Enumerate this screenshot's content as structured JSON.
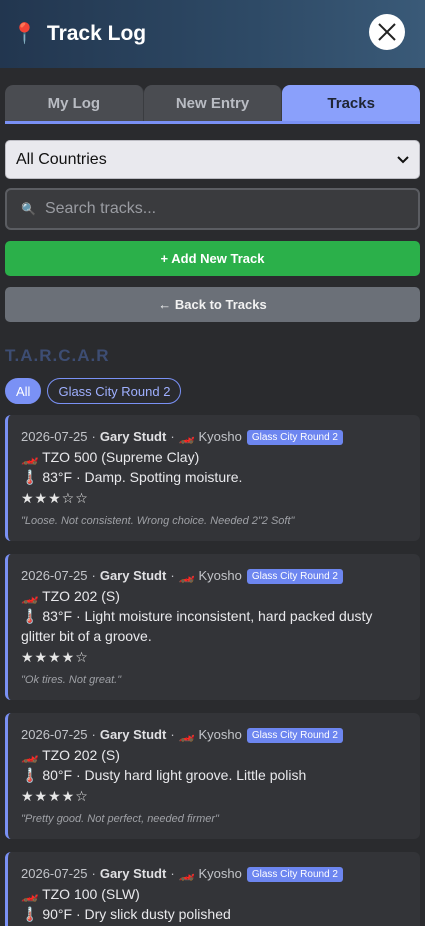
{
  "header": {
    "pin_icon": "📍",
    "title": "Track Log"
  },
  "tabs": [
    {
      "label": "My Log",
      "active": false
    },
    {
      "label": "New Entry",
      "active": false
    },
    {
      "label": "Tracks",
      "active": true
    }
  ],
  "country_select": {
    "value": "All Countries"
  },
  "search": {
    "icon": "🔍",
    "placeholder": "Search tracks..."
  },
  "buttons": {
    "add": "+ Add New Track",
    "back": "← Back to Tracks"
  },
  "section": {
    "title": "T.A.R.C.A.R"
  },
  "chips": [
    {
      "label": "All",
      "active": true
    },
    {
      "label": "Glass City Round 2",
      "active": false
    }
  ],
  "entries": [
    {
      "date": "2026-07-25",
      "author": "Gary Studt",
      "car_icon": "🏎️",
      "car": "Kyosho",
      "event": "Glass City Round 2",
      "tire_icon": "🏎️",
      "tire": "TZO 500 (Supreme Clay)",
      "temp_icon": "🌡️",
      "conditions": "83°F · Damp. Spotting moisture.",
      "stars": "★★★☆☆",
      "note": "\"Loose. Not consistent. Wrong choice. Needed 2\"2 Soft\""
    },
    {
      "date": "2026-07-25",
      "author": "Gary Studt",
      "car_icon": "🏎️",
      "car": "Kyosho",
      "event": "Glass City Round 2",
      "tire_icon": "🏎️",
      "tire": "TZO 202 (S)",
      "temp_icon": "🌡️",
      "conditions": "83°F · Light moisture inconsistent, hard packed dusty glitter bit of a groove.",
      "stars": "★★★★☆",
      "note": "\"Ok tires. Not great.\""
    },
    {
      "date": "2026-07-25",
      "author": "Gary Studt",
      "car_icon": "🏎️",
      "car": "Kyosho",
      "event": "Glass City Round 2",
      "tire_icon": "🏎️",
      "tire": "TZO 202 (S)",
      "temp_icon": "🌡️",
      "conditions": "80°F · Dusty hard light groove. Little polish",
      "stars": "★★★★☆",
      "note": "\"Pretty good. Not perfect, needed firmer\""
    },
    {
      "date": "2026-07-25",
      "author": "Gary Studt",
      "car_icon": "🏎️",
      "car": "Kyosho",
      "event": "Glass City Round 2",
      "tire_icon": "🏎️",
      "tire": "TZO 100 (SLW)",
      "temp_icon": "🌡️",
      "conditions": "90°F · Dry slick dusty polished",
      "stars": "",
      "note": ""
    }
  ]
}
